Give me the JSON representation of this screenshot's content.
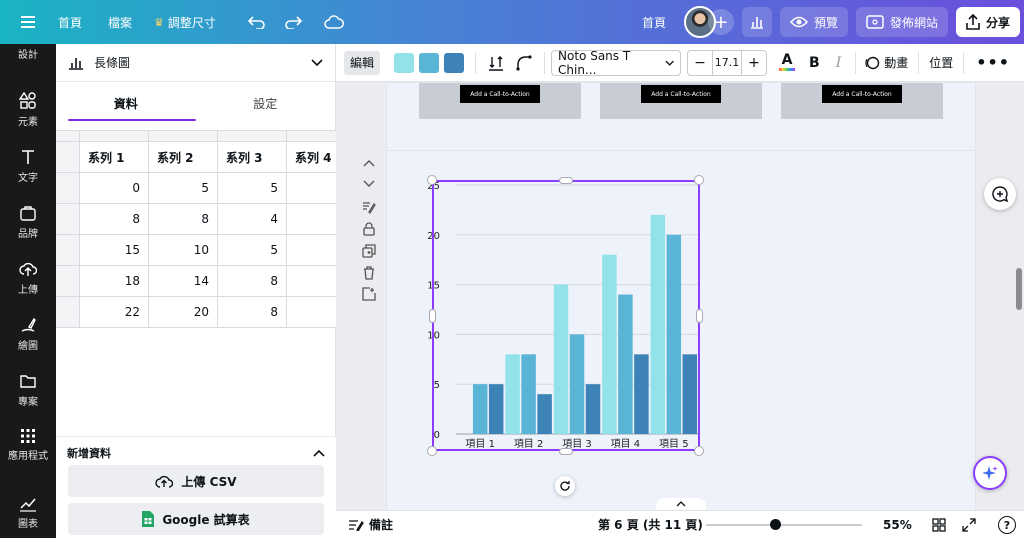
{
  "topbar": {
    "home": "首頁",
    "file": "檔案",
    "resize": "調整尺寸",
    "page_home": "首頁",
    "preview": "預覽",
    "publish": "發佈網站",
    "share": "分享"
  },
  "rail": {
    "items": [
      {
        "label": "設計",
        "icon": "design-icon"
      },
      {
        "label": "元素",
        "icon": "elements-icon"
      },
      {
        "label": "文字",
        "icon": "text-icon"
      },
      {
        "label": "品牌",
        "icon": "brand-icon"
      },
      {
        "label": "上傳",
        "icon": "upload-icon"
      },
      {
        "label": "繪圖",
        "icon": "draw-icon"
      },
      {
        "label": "專案",
        "icon": "folder-icon"
      },
      {
        "label": "應用程式",
        "icon": "apps-icon"
      },
      {
        "label": "圖表",
        "icon": "chart-icon"
      }
    ]
  },
  "panel": {
    "chart_type": "長條圖",
    "tabs": [
      "資料",
      "設定"
    ],
    "headers": [
      "系列 1",
      "系列 2",
      "系列 3",
      "系列 4"
    ],
    "rows": [
      [
        "0",
        "5",
        "5",
        ""
      ],
      [
        "8",
        "8",
        "4",
        ""
      ],
      [
        "15",
        "10",
        "5",
        ""
      ],
      [
        "18",
        "14",
        "8",
        ""
      ],
      [
        "22",
        "20",
        "8",
        ""
      ]
    ],
    "add_data_title": "新增資料",
    "upload_csv": "上傳 CSV",
    "google_sheets": "Google 試算表"
  },
  "toolbar": {
    "edit": "編輯",
    "colors": [
      "#92e3e9",
      "#5ab4d6",
      "#3e83b8"
    ],
    "font": "Noto Sans T Chin...",
    "font_size": "17.1",
    "animate": "動畫",
    "position": "位置"
  },
  "canvas": {
    "cta_label": "Add a Call-to-Action"
  },
  "chart_data": {
    "type": "bar",
    "categories": [
      "項目 1",
      "項目 2",
      "項目 3",
      "項目 4",
      "項目 5"
    ],
    "series": [
      {
        "name": "系列 1",
        "values": [
          0,
          8,
          15,
          18,
          22
        ],
        "color": "#92e3e9"
      },
      {
        "name": "系列 2",
        "values": [
          5,
          8,
          10,
          14,
          20
        ],
        "color": "#5ab4d6"
      },
      {
        "name": "系列 3",
        "values": [
          5,
          4,
          5,
          8,
          8
        ],
        "color": "#3e83b8"
      }
    ],
    "ylim": [
      0,
      25
    ],
    "yticks": [
      "0",
      "5",
      "10",
      "15",
      "20",
      "25"
    ],
    "grid": true,
    "title": "",
    "xlabel": "",
    "ylabel": ""
  },
  "status": {
    "notes": "備註",
    "page_info": "第 6 頁 (共 11 頁)",
    "zoom": "55%",
    "help": "?"
  }
}
